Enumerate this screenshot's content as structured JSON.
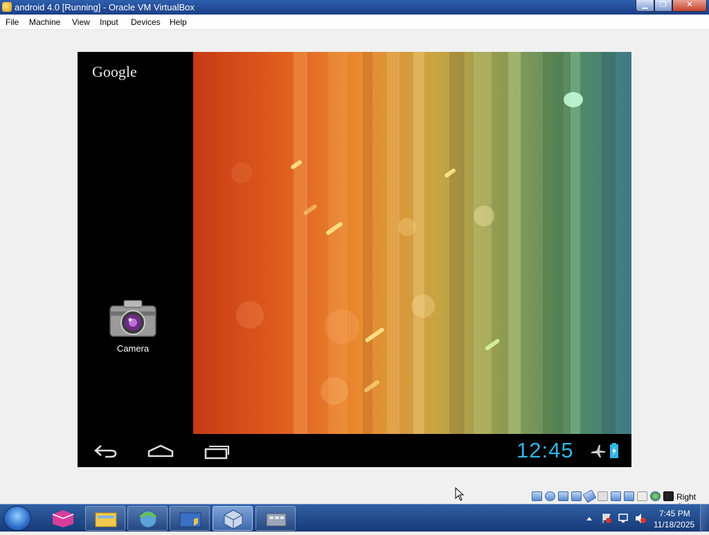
{
  "window": {
    "title": "android 4.0 [Running] - Oracle VM VirtualBox",
    "icon": "virtualbox-icon",
    "controls": {
      "minimize": "▁",
      "maximize": "❐",
      "close": "✕"
    }
  },
  "menubar": {
    "items": [
      "File",
      "Machine",
      "View",
      "Input",
      "Devices",
      "Help"
    ]
  },
  "android": {
    "search_logo": "Google",
    "apps_button": "apps-grid-icon",
    "desktop_apps": [
      {
        "label": "Camera",
        "icon": "camera-icon"
      }
    ],
    "navbar": {
      "back": "back-icon",
      "home": "home-icon",
      "recents": "recent-apps-icon",
      "clock": "12:45",
      "airplane": "airplane-mode-icon",
      "battery": "battery-charging-icon"
    },
    "accent_color": "#33b5e5"
  },
  "vbox_status": {
    "icons": [
      "hard-disk-icon",
      "optical-drive-icon",
      "audio-icon",
      "network-icon",
      "usb-icon",
      "shared-folder-icon",
      "display-icon",
      "video-capture-icon",
      "mouse-integration-icon",
      "keyboard-icon"
    ],
    "host_key": "Right Ctrl"
  },
  "taskbar": {
    "start": "start-orb-icon",
    "apps": [
      "app-pinned-1",
      "windows-explorer",
      "browser",
      "control-panel",
      "virtualbox",
      "virtualbox-vm"
    ],
    "clock_time": "7:45 PM",
    "clock_date": "11/18/2025",
    "tray_icons": [
      "show-hidden-icons",
      "action-center-icon",
      "network-icon",
      "volume-muted-icon"
    ]
  }
}
